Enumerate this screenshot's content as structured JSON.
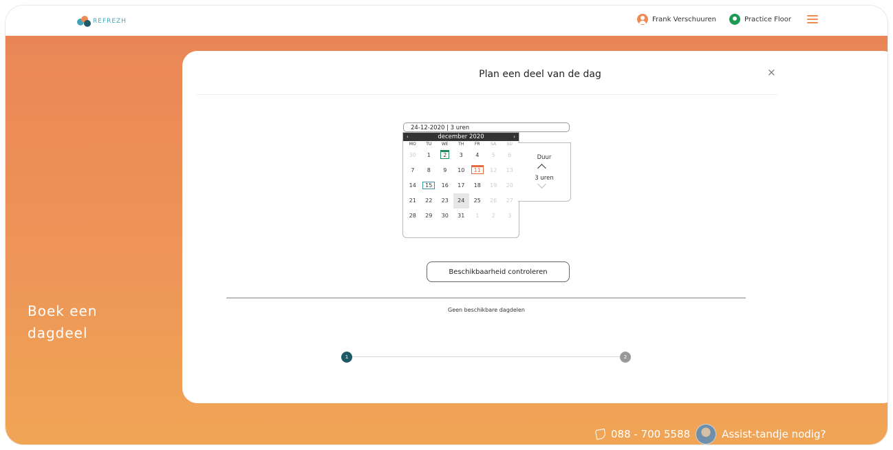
{
  "header": {
    "logo_text": "REFREZH",
    "user_name": "Frank Verschuuren",
    "location": "Practice Floor"
  },
  "side": {
    "title_line1": "Boek een",
    "title_line2": "dagdeel"
  },
  "modal": {
    "title": "Plan een deel van de dag",
    "close_symbol": "×"
  },
  "calendar": {
    "input_value": "24-12-2020 | 3 uren",
    "month_label": "december 2020",
    "prev": "‹",
    "next": "›",
    "weekdays": [
      "MO",
      "TU",
      "WE",
      "TH",
      "FR",
      "SA",
      "SU"
    ],
    "days": [
      "30",
      "1",
      "2",
      "3",
      "4",
      "5",
      "6",
      "7",
      "8",
      "9",
      "10",
      "11",
      "12",
      "13",
      "14",
      "15",
      "16",
      "17",
      "18",
      "19",
      "20",
      "21",
      "22",
      "23",
      "24",
      "25",
      "26",
      "27",
      "28",
      "29",
      "30",
      "31",
      "1",
      "2",
      "3"
    ]
  },
  "duration": {
    "label": "Duur",
    "value": "3 uren"
  },
  "actions": {
    "check_label": "Beschikbaarheid controleren",
    "empty_message": "Geen beschikbare dagdelen"
  },
  "steps": {
    "step1": "1",
    "step2": "2"
  },
  "footer": {
    "phone": "088 - 700 5588",
    "assist": "Assist-tandje nodig?"
  },
  "colors": {
    "accent_orange": "#ea8656",
    "step_active": "#1e5a66",
    "today_green": "#1f8a5e"
  }
}
